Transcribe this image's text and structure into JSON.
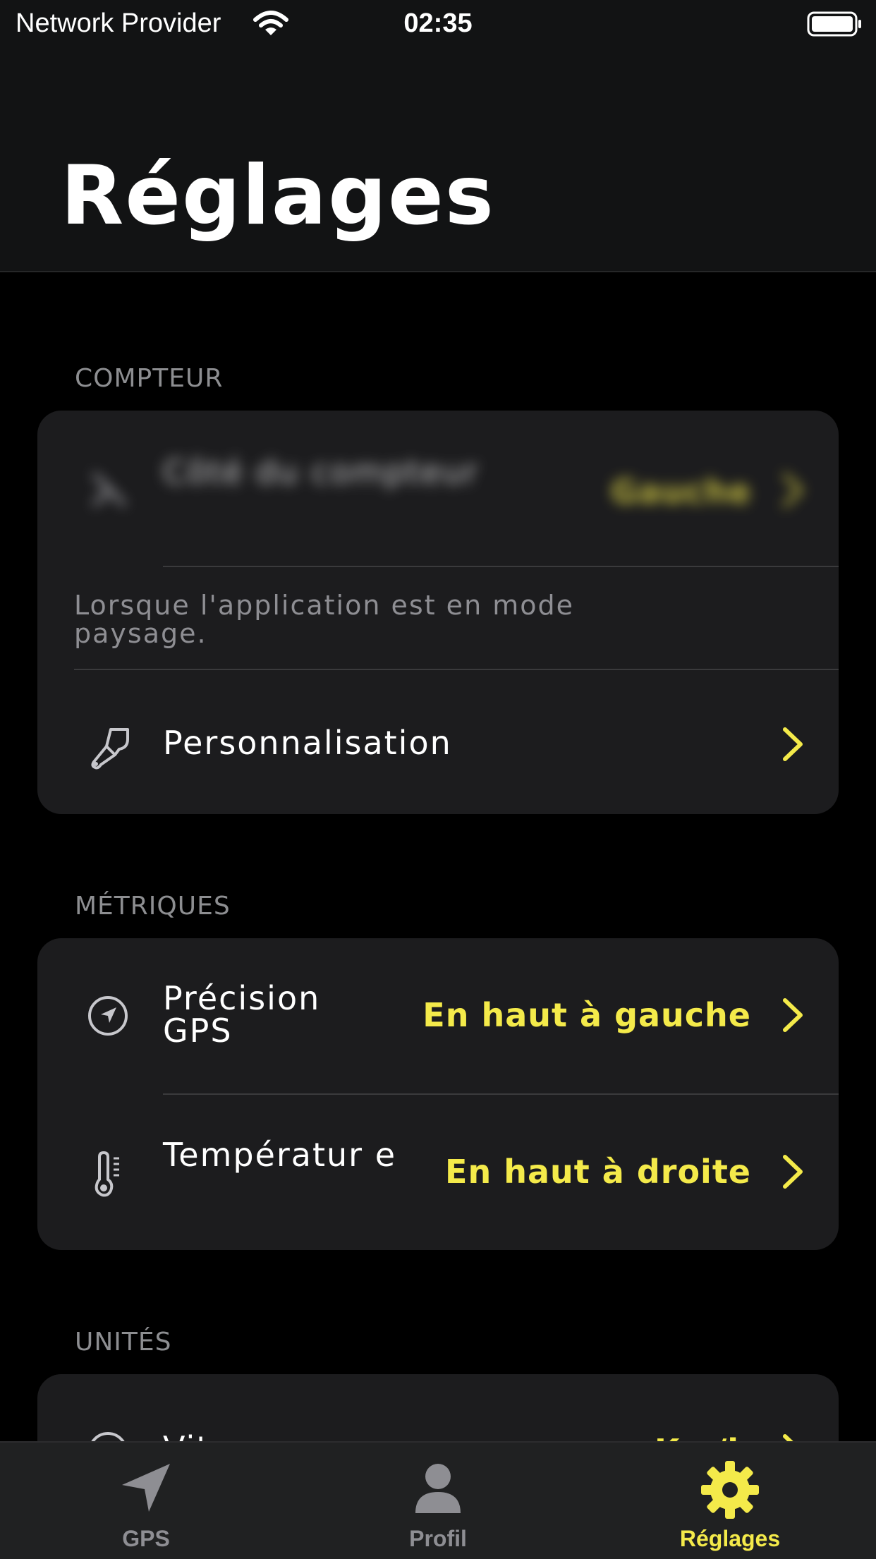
{
  "status_bar": {
    "carrier": "Network Provider",
    "time": "02:35"
  },
  "header": {
    "title": "Réglages"
  },
  "sections": {
    "compteur": {
      "label": "COMPTEUR",
      "side_row": {
        "label": "Côté du compteur",
        "value": "Gauche"
      },
      "footnote": "Lorsque l'application est en mode paysage.",
      "personalisation_row": {
        "label": "Personnalisation"
      }
    },
    "metriques": {
      "label": "MÉTRIQUES",
      "gps_row": {
        "label": "Précision GPS",
        "value": "En haut à gauche"
      },
      "temperature_row": {
        "label": "Températur e",
        "value": "En haut à droite"
      }
    },
    "unites": {
      "label": "UNITÉS",
      "speed_row": {
        "label": "Vitesse",
        "value": "Km/h"
      }
    }
  },
  "tab_bar": {
    "tabs": [
      {
        "label": "GPS",
        "icon": "location-arrow-icon",
        "active": false
      },
      {
        "label": "Profil",
        "icon": "person-icon",
        "active": false
      },
      {
        "label": "Réglages",
        "icon": "gear-icon",
        "active": true
      }
    ]
  },
  "colors": {
    "accent": "#f4ea4a",
    "card": "#1c1c1e",
    "header": "#121314",
    "inactive": "#8e8e93"
  }
}
